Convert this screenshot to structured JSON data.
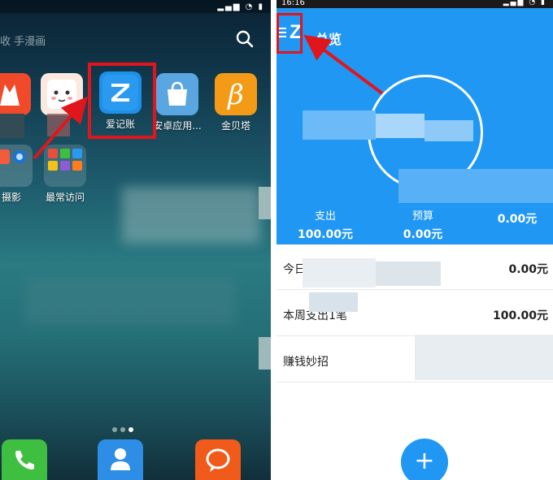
{
  "left_screen": {
    "search": {
      "hint": "收 手漫画"
    },
    "apps": [
      {
        "label": "",
        "icon": "fox-icon",
        "color": "#f04a2a"
      },
      {
        "label": "",
        "icon": "cute-face-icon",
        "color": "#fbe9df"
      },
      {
        "label": "爱记账",
        "icon": "z-letter-icon",
        "color": "#1f8fe8"
      },
      {
        "label": "安卓应用...",
        "icon": "shopping-bag-icon",
        "color": "#2d8fd6"
      },
      {
        "label": "金贝塔",
        "icon": "beta-icon",
        "color": "#f39a16"
      }
    ],
    "folders": [
      {
        "label": "摄影"
      },
      {
        "label": "最常访问"
      }
    ],
    "dock": [
      {
        "icon": "phone-icon",
        "color": "#3fbf3f"
      },
      {
        "icon": "contacts-icon",
        "color": "#2e8ee6"
      },
      {
        "icon": "message-icon",
        "color": "#f05a1a"
      }
    ]
  },
  "right_screen": {
    "status": {
      "time": "16:16"
    },
    "header": {
      "logo": "Z",
      "title": "总览"
    },
    "stats": [
      {
        "label": "支出",
        "value": "100.00元"
      },
      {
        "label": "预算",
        "value": "0.00元"
      },
      {
        "label": "",
        "value": "0.00元"
      }
    ],
    "rows": [
      {
        "label": "今日支出",
        "value": "0.00元"
      },
      {
        "label": "本周支出1笔",
        "value": "100.00元"
      },
      {
        "label": "赚钱妙招",
        "value": ""
      }
    ],
    "fab": {
      "label": "+"
    }
  },
  "colors": {
    "accent_blue": "#1f97f3",
    "highlight_red": "#e0161c"
  }
}
